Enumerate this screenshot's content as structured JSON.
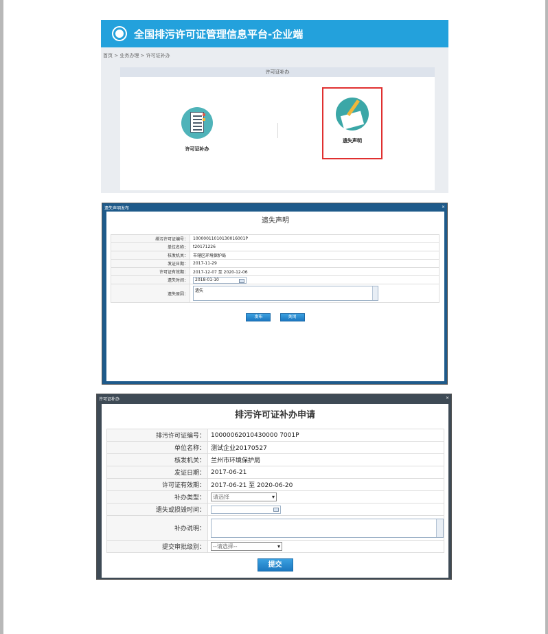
{
  "portal": {
    "title": "全国排污许可证管理信息平台-企业端",
    "breadcrumb": "首页 > 业务办理 > 许可证补办",
    "panel_title": "许可证补办",
    "options": [
      {
        "label": "许可证补办",
        "icon": "document-icon"
      },
      {
        "label": "遗失声明",
        "icon": "pen-icon"
      }
    ],
    "colors": {
      "header": "#23a1dc",
      "highlight": "#e03030"
    }
  },
  "loss_dialog": {
    "window_title": "遗失声明发布",
    "close": "×",
    "title": "遗失声明",
    "fields": [
      {
        "label": "排污许可证编号：",
        "value": "10000011010130016001P"
      },
      {
        "label": "单位名称：",
        "value": "t20171226"
      },
      {
        "label": "核发机关：",
        "value": "市辖区环境保护局"
      },
      {
        "label": "发证日期：",
        "value": "2017-11-29"
      },
      {
        "label": "许可证有效期：",
        "value": "2017-12-07 至 2020-12-06"
      }
    ],
    "loss_time_label": "遗失时间：",
    "loss_time_value": "2018-01-10",
    "loss_reason_label": "遗失原因：",
    "loss_reason_value": "遗失",
    "publish_button": "发布",
    "close_button": "关闭"
  },
  "reissue_dialog": {
    "window_title": "许可证补办",
    "close": "×",
    "title": "排污许可证补办申请",
    "fields": [
      {
        "label": "排污许可证编号：",
        "value": "10000062010430000 7001P"
      },
      {
        "label": "单位名称：",
        "value": "测试企业20170527"
      },
      {
        "label": "核发机关：",
        "value": "兰州市环境保护局"
      },
      {
        "label": "发证日期：",
        "value": "2017-06-21"
      },
      {
        "label": "许可证有效期：",
        "value": "2017-06-21 至 2020-06-20"
      }
    ],
    "type_label": "补办类型：",
    "type_value": "请选择",
    "time_label": "遗失或损毁时间：",
    "time_value": "",
    "desc_label": "补办说明：",
    "desc_value": "",
    "level_label": "提交审批级别：",
    "level_value": "--请选择--",
    "submit_button": "提交"
  }
}
